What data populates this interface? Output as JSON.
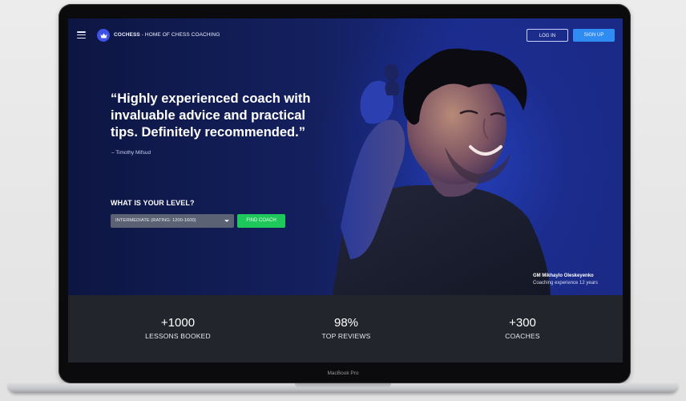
{
  "header": {
    "brand_name": "COCHESS",
    "brand_tagline": " - HOME OF CHESS COACHING",
    "login_label": "LOG IN",
    "signup_label": "SIGN UP"
  },
  "hero": {
    "quote": "“Highly experienced coach with invaluable advice and practical tips. Definitely recommended.”",
    "quote_author": "– Timothy Mifsud",
    "level_label": "WHAT IS YOUR LEVEL?",
    "level_selected": "INTERMEDIATE (RATING: 1200-1600)",
    "find_coach_label": "FIND COACH",
    "coach_name": "GM Mikhaylo Oleskeyenko",
    "coach_experience": "Coaching experience 12 years"
  },
  "stats": [
    {
      "value": "+1000",
      "label": "LESSONS BOOKED"
    },
    {
      "value": "98%",
      "label": "TOP REVIEWS"
    },
    {
      "value": "+300",
      "label": "COACHES"
    }
  ],
  "device": {
    "model_label": "MacBook Pro"
  },
  "colors": {
    "hero_blue": "#1a2b8a",
    "signup_blue": "#2f8cf2",
    "find_green": "#1fc85a",
    "stats_bg": "#22262c"
  },
  "icons": [
    "menu-icon",
    "crown-logo-icon",
    "chevron-down-icon"
  ]
}
